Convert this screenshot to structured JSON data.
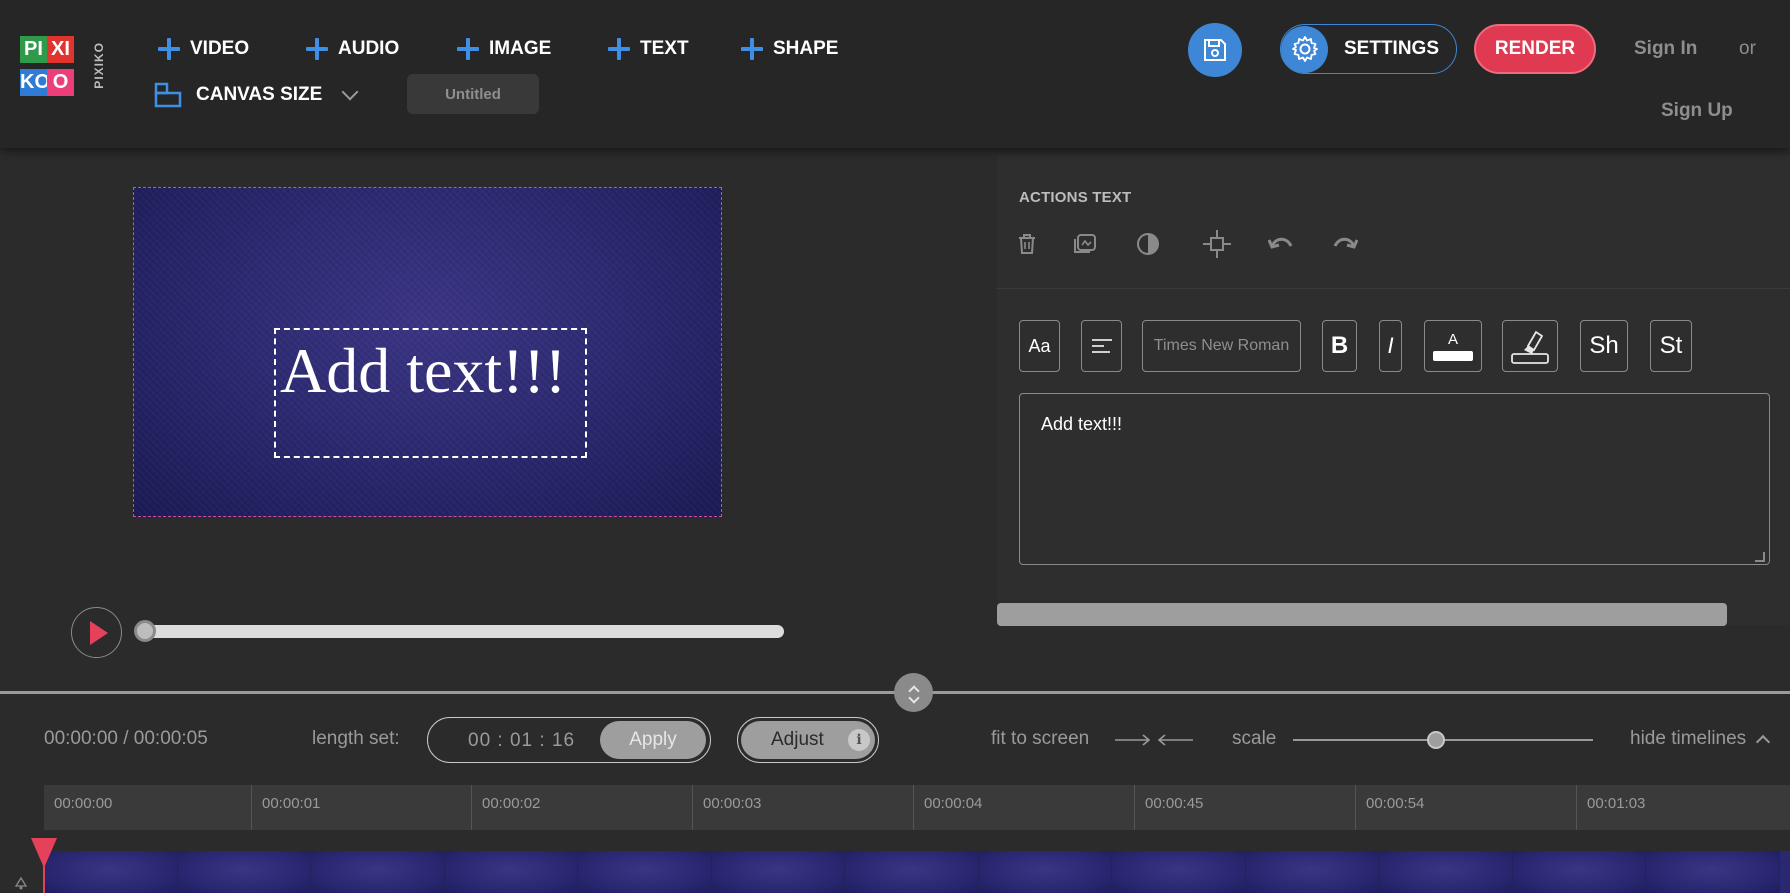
{
  "logo": {
    "tiles": [
      "PI",
      "XI",
      "KO",
      "O"
    ],
    "wordmark": "PIXIKO"
  },
  "header": {
    "add_buttons": [
      "VIDEO",
      "AUDIO",
      "IMAGE",
      "TEXT",
      "SHAPE"
    ],
    "canvas_size_label": "CANVAS SIZE",
    "project_title_placeholder": "Untitled",
    "settings_label": "SETTINGS",
    "render_label": "RENDER",
    "sign_in": "Sign In",
    "or": "or",
    "sign_up": "Sign Up"
  },
  "canvas": {
    "text": "Add text!!!"
  },
  "panel": {
    "title": "ACTIONS TEXT",
    "action_icons": [
      "trash-icon",
      "copy-icon",
      "contrast-icon",
      "center-icon",
      "undo-icon",
      "redo-icon"
    ],
    "tools": {
      "font_case": "Aa",
      "font_family_placeholder": "Times New Roman",
      "bold": "B",
      "italic": "I",
      "text_color_letter": "A",
      "shadow": "Sh",
      "stroke": "St"
    },
    "text_value": "Add text!!!"
  },
  "timeline": {
    "timecode": "00:00:00 / 00:00:05",
    "length_label": "length set:",
    "length_value": "00 : 01 : 16",
    "apply": "Apply",
    "adjust": "Adjust",
    "info": "i",
    "fit_to_screen": "fit to screen",
    "scale": "scale",
    "scale_level": 0.48,
    "hide_timelines": "hide timelines",
    "ticks": [
      "00:00:00",
      "00:00:01",
      "00:00:02",
      "00:00:03",
      "00:00:04",
      "00:00:45",
      "00:00:54",
      "00:01:03"
    ]
  },
  "colors": {
    "accent_blue": "#3e86d6",
    "render_red": "#e03a52",
    "playhead_red": "#e5415b",
    "background": "#2b2b2b"
  }
}
